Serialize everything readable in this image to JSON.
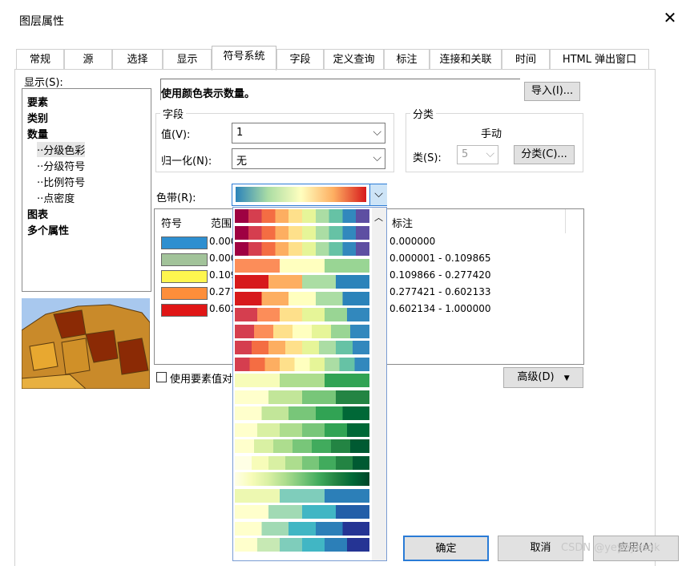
{
  "window": {
    "title": "图层属性",
    "close_symbol": "✕"
  },
  "tabs": [
    "常规",
    "源",
    "选择",
    "显示",
    "符号系统",
    "字段",
    "定义查询",
    "标注",
    "连接和关联",
    "时间",
    "HTML 弹出窗口"
  ],
  "active_tab": "符号系统",
  "left": {
    "show_label": "显示(S):",
    "items": [
      {
        "label": "要素",
        "bold": true
      },
      {
        "label": "类别",
        "bold": true
      },
      {
        "label": "数量",
        "bold": true
      },
      {
        "label": "分级色彩",
        "bold": false,
        "indent": true
      },
      {
        "label": "分级符号",
        "bold": false,
        "indent": true
      },
      {
        "label": "比例符号",
        "bold": false,
        "indent": true
      },
      {
        "label": "点密度",
        "bold": false,
        "indent": true
      },
      {
        "label": "图表",
        "bold": true
      },
      {
        "label": "多个属性",
        "bold": true
      }
    ]
  },
  "main": {
    "heading": "使用颜色表示数量。",
    "import_button": "导入(I)...",
    "field_group": "字段",
    "value_label": "值(V):",
    "value": "1",
    "normalize_label": "归一化(N):",
    "normalize": "无",
    "classification_group": "分类",
    "method": "手动",
    "classes_label": "类(S):",
    "classes": "5",
    "classify_button": "分类(C)...",
    "ramp_label": "色带(R):",
    "table_headers": {
      "symbol": "符号",
      "range": "范围",
      "label": "标注"
    },
    "rows": [
      {
        "color": "#2e8fd0",
        "range": "0.000000",
        "label": "0.000000"
      },
      {
        "color": "#a2c39a",
        "range": "0.000001 - 0.109865",
        "label": "0.000001 - 0.109865"
      },
      {
        "color": "#fef64f",
        "range": "0.109866 - 0.277420",
        "label": "0.109866 - 0.277420"
      },
      {
        "color": "#fd8e3a",
        "range": "0.277421 - 0.602133",
        "label": "0.277421 - 0.602133"
      },
      {
        "color": "#e01616",
        "range": "0.602134 - 1.000000",
        "label": "0.602134 - 1.000000"
      }
    ],
    "use_feature_values": "使用要素值对",
    "advanced_button": "高级(D)"
  },
  "footer": {
    "ok": "确定",
    "cancel": "取消",
    "apply": "应用(A)"
  },
  "watermark": "CSDN @yeyeyesok"
}
